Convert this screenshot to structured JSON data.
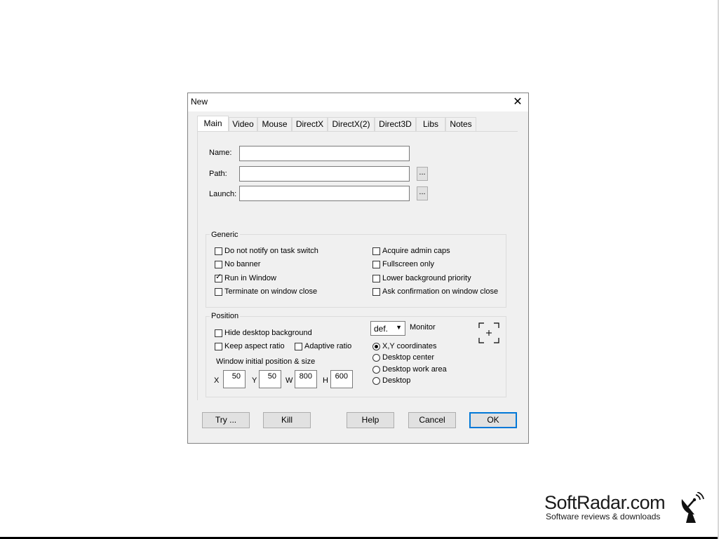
{
  "dialog": {
    "title": "New"
  },
  "tabs": [
    {
      "label": "Main",
      "active": true
    },
    {
      "label": "Video"
    },
    {
      "label": "Mouse"
    },
    {
      "label": "DirectX"
    },
    {
      "label": "DirectX(2)"
    },
    {
      "label": "Direct3D"
    },
    {
      "label": "Libs"
    },
    {
      "label": "Notes"
    }
  ],
  "fields": {
    "name_label": "Name:",
    "name_value": "",
    "path_label": "Path:",
    "path_value": "",
    "launch_label": "Launch:",
    "launch_value": "",
    "browse_label": "..."
  },
  "generic": {
    "title": "Generic",
    "options": [
      {
        "label": "Do not notify on task switch",
        "checked": false
      },
      {
        "label": "No banner",
        "checked": false
      },
      {
        "label": "Run in Window",
        "checked": true
      },
      {
        "label": "Terminate on window close",
        "checked": false
      },
      {
        "label": "Acquire admin caps",
        "checked": false
      },
      {
        "label": "Fullscreen only",
        "checked": false
      },
      {
        "label": "Lower background priority",
        "checked": false
      },
      {
        "label": "Ask confirmation on window close",
        "checked": false
      }
    ]
  },
  "position": {
    "title": "Position",
    "hide_desktop": {
      "label": "Hide desktop background",
      "checked": false
    },
    "keep_aspect": {
      "label": "Keep aspect ratio",
      "checked": false
    },
    "adaptive": {
      "label": "Adaptive ratio",
      "checked": false
    },
    "initial_label": "Window initial position & size",
    "x_label": "X",
    "x_value": "50",
    "y_label": "Y",
    "y_value": "50",
    "w_label": "W",
    "w_value": "800",
    "h_label": "H",
    "h_value": "600",
    "monitor_select": "def.",
    "monitor_label": "Monitor",
    "radios": [
      {
        "label": "X,Y coordinates",
        "selected": true
      },
      {
        "label": "Desktop center",
        "selected": false
      },
      {
        "label": "Desktop work area",
        "selected": false
      },
      {
        "label": "Desktop",
        "selected": false
      }
    ]
  },
  "buttons": {
    "try": "Try ...",
    "kill": "Kill",
    "help": "Help",
    "cancel": "Cancel",
    "ok": "OK"
  },
  "watermark": {
    "name": "SoftRadar.com",
    "tagline": "Software reviews & downloads"
  }
}
